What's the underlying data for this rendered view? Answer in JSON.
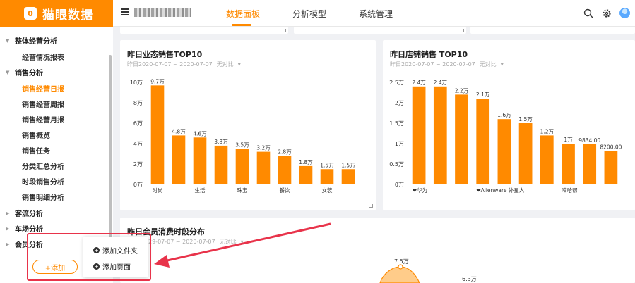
{
  "brand": {
    "name": "猫眼数据",
    "logo_char": "0"
  },
  "nav": {
    "tabs": [
      "数据面板",
      "分析模型",
      "系统管理"
    ],
    "active": 0
  },
  "sidebar": {
    "groups": [
      {
        "label": "整体经营分析",
        "children": [
          "经营情况报表"
        ]
      },
      {
        "label": "销售分析",
        "children": [
          "销售经营日报",
          "销售经营周报",
          "销售经营月报",
          "销售概览",
          "销售任务",
          "分类汇总分析",
          "时段销售分析",
          "销售明细分析"
        ]
      },
      {
        "label": "客流分析",
        "children": []
      },
      {
        "label": "车场分析",
        "children": []
      },
      {
        "label": "会员分析",
        "children": []
      }
    ],
    "active_child": "销售经营日报",
    "add_label": "+添加"
  },
  "popup": {
    "items": [
      "添加文件夹",
      "添加页面"
    ]
  },
  "cards": {
    "left": {
      "title": "昨日业态销售TOP10",
      "date_range": "昨日2020-07-07 ~ 2020-07-07",
      "compare": "无对比"
    },
    "right": {
      "title": "昨日店铺销售 TOP10",
      "date_range": "昨日2020-07-07 ~ 2020-07-07",
      "compare": "无对比"
    },
    "bottom": {
      "title": "昨日会员消费时段分布",
      "date_range": "29-07-07 ~ 2020-07-07",
      "compare": "无对比",
      "peak_labels": [
        "7.5万",
        "6.3万"
      ]
    }
  },
  "chart_data": [
    {
      "type": "bar",
      "title": "昨日业态销售TOP10",
      "categories": [
        "时尚",
        "",
        "生活",
        "",
        "珠宝",
        "",
        "餐饮",
        "",
        "女装",
        ""
      ],
      "values": [
        97000,
        48000,
        46000,
        38000,
        35000,
        32000,
        28000,
        18000,
        15000,
        15000
      ],
      "data_labels": [
        "9.7万",
        "4.8万",
        "4.6万",
        "3.8万",
        "3.5万",
        "3.2万",
        "2.8万",
        "1.8万",
        "1.5万",
        "1.5万"
      ],
      "y_ticks": [
        "0万",
        "2万",
        "4万",
        "6万",
        "8万",
        "10万"
      ],
      "ylim": [
        0,
        100000
      ],
      "color": "#ff8a00"
    },
    {
      "type": "bar",
      "title": "昨日店铺销售 TOP10",
      "categories": [
        "❤华为",
        "",
        "",
        "❤Alienware 外星人",
        "",
        "",
        "",
        "嘀哈帮",
        "",
        ""
      ],
      "values": [
        24000,
        24000,
        22000,
        21000,
        16000,
        15000,
        12000,
        10000,
        9834,
        8200
      ],
      "data_labels": [
        "2.4万",
        "2.4万",
        "2.2万",
        "2.1万",
        "1.6万",
        "1.5万",
        "1.2万",
        "1万",
        "9834.00",
        "8200.00"
      ],
      "y_ticks": [
        "0万",
        "0.5万",
        "1万",
        "1.5万",
        "2万",
        "2.5万"
      ],
      "ylim": [
        0,
        25000
      ],
      "color": "#ff8a00"
    }
  ],
  "colors": {
    "accent": "#ff8a00",
    "annotation": "#e8334a"
  }
}
